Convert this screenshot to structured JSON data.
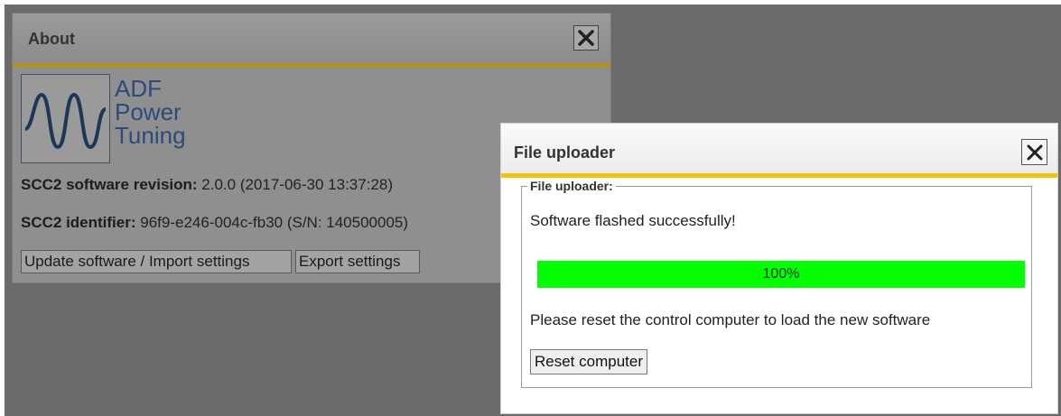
{
  "about_dialog": {
    "title": "About",
    "logo": {
      "line1": "ADF",
      "line2": "Power",
      "line3": "Tuning"
    },
    "software_revision_label": "SCC2 software revision:",
    "software_revision_value": "2.0.0 (2017-06-30 13:37:28)",
    "identifier_label": "SCC2 identifier:",
    "identifier_value": "96f9-e246-004c-fb30 (S/N: 140500005)",
    "update_button": "Update software / Import settings",
    "export_button": "Export settings"
  },
  "uploader_dialog": {
    "title": "File uploader",
    "fieldset_legend": "File uploader:",
    "status_message": "Software flashed successfully!",
    "progress": {
      "percent": 100,
      "label": "100%"
    },
    "instruction": "Please reset the control computer to load the new software",
    "reset_button": "Reset computer"
  },
  "colors": {
    "accent_bar": "#f1c40f",
    "progress_fill": "#00ff00",
    "logo_blue": "#2c4a7a"
  },
  "icons": [
    "close-icon",
    "adf-logo-wave-icon"
  ]
}
